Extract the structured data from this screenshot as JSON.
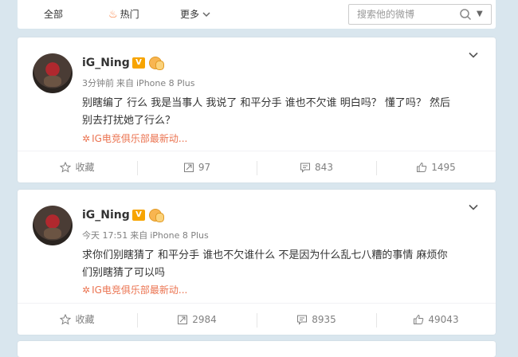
{
  "nav": {
    "all": "全部",
    "hot": "热门",
    "more": "更多",
    "search_placeholder": "搜索他的微博"
  },
  "colors": {
    "accent_orange": "#eb7350",
    "badge_gold": "#f7a400",
    "page_bg": "#d9e6ee"
  },
  "posts": [
    {
      "author": "iG_Ning",
      "verified_badge": "V",
      "time": "3分钟前",
      "from_label": "来自",
      "device": "iPhone 8 Plus",
      "text_line1": "别瞎编了 行么 我是当事人 我说了 和平分手 谁也不欠谁 明白吗？ 懂了吗？ 然后",
      "text_line2": "别去打扰她了行么？",
      "source": "IG电竞俱乐部最新动...",
      "favorite": "收藏",
      "reposts": "97",
      "comments": "843",
      "likes": "1495"
    },
    {
      "author": "iG_Ning",
      "verified_badge": "V",
      "time": "今天 17:51",
      "from_label": "来自",
      "device": "iPhone 8 Plus",
      "text_line1": "求你们别瞎猜了 和平分手 谁也不欠谁什么 不是因为什么乱七八糟的事情 麻烦你",
      "text_line2": "们别瞎猜了可以吗",
      "source": "IG电竞俱乐部最新动...",
      "favorite": "收藏",
      "reposts": "2984",
      "comments": "8935",
      "likes": "49043"
    }
  ]
}
